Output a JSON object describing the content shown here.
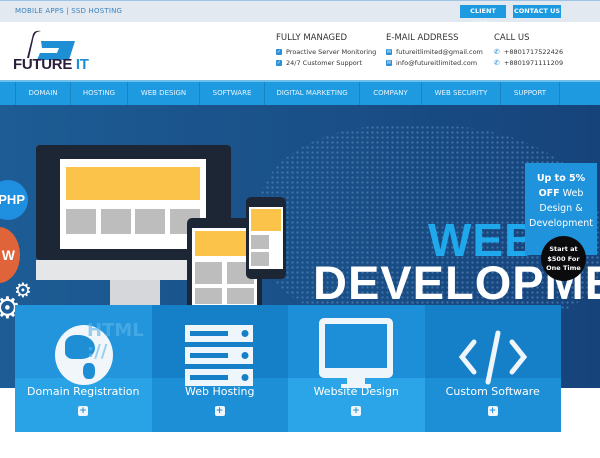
{
  "topbar": {
    "tagline": "MOBILE APPS | SSD HOSTING",
    "client_area": "CLIENT AREA",
    "contact_us": "CONTACT US"
  },
  "brand": {
    "name_part1": "FUTURE",
    "name_part2": " IT"
  },
  "header": {
    "managed": {
      "title": "FULLY MANAGED",
      "items": [
        "Proactive Server Monitoring",
        "24/7 Customer Support"
      ]
    },
    "email": {
      "title": "E-MAIL ADDRESS",
      "items": [
        "futureitlimited@gmail.com",
        "info@futureitlimited.com"
      ]
    },
    "call": {
      "title": "CALL US",
      "items": [
        "+8801717522426",
        "+8801971111209"
      ]
    }
  },
  "nav": [
    "DOMAIN",
    "HOSTING",
    "WEB DESIGN",
    "SOFTWARE",
    "DIGITAL MARKETING",
    "COMPANY",
    "WEB SECURITY",
    "SUPPORT"
  ],
  "hero": {
    "headline1": "WEB",
    "headline2": "DEVELOPMEN",
    "badge_php": "PHP",
    "badge_w": "W",
    "watermark": "HTML ://",
    "promo": {
      "line1": "Up to 5%",
      "line2_bold": "OFF",
      "line2": " Web",
      "line3": "Design &",
      "line4": "Development"
    },
    "offer": {
      "line1": "Start at",
      "line2": "$500 For",
      "line3": "One Time"
    }
  },
  "services": [
    {
      "label": "Domain Registration",
      "icon": "globe-icon"
    },
    {
      "label": "Web Hosting",
      "icon": "server-icon"
    },
    {
      "label": "Website Design",
      "icon": "monitor-icon"
    },
    {
      "label": "Custom Software",
      "icon": "code-icon"
    }
  ],
  "colors": {
    "accent": "#1e9ae0",
    "hero_bg": "#1a4f87",
    "web_text": "#1fa8ec"
  }
}
